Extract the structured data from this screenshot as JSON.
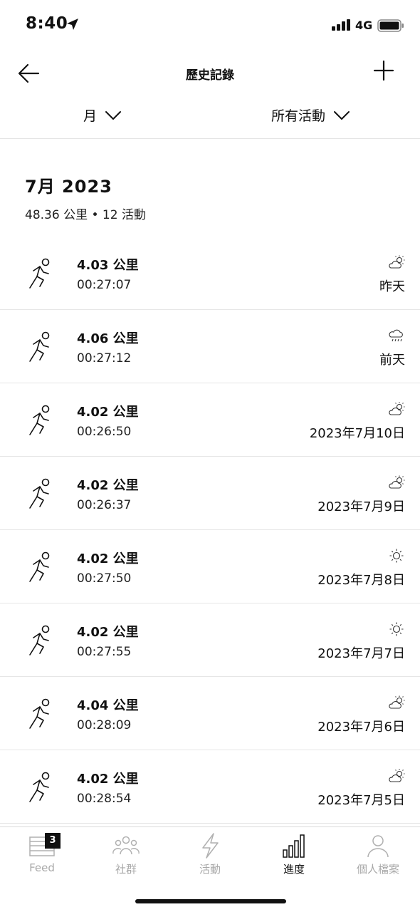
{
  "status_bar": {
    "time": "8:40",
    "network": "4G"
  },
  "nav": {
    "title": "歷史記錄"
  },
  "filters": {
    "period": "月",
    "activity": "所有活動"
  },
  "summary": {
    "title": "7月 2023",
    "subtitle": "48.36 公里 • 12 活動"
  },
  "activities": [
    {
      "distance": "4.03 公里",
      "duration": "00:27:07",
      "date": "昨天",
      "weather": "partly-sunny-icon"
    },
    {
      "distance": "4.06 公里",
      "duration": "00:27:12",
      "date": "前天",
      "weather": "rain-icon"
    },
    {
      "distance": "4.02 公里",
      "duration": "00:26:50",
      "date": "2023年7月10日",
      "weather": "partly-sunny-icon"
    },
    {
      "distance": "4.02 公里",
      "duration": "00:26:37",
      "date": "2023年7月9日",
      "weather": "partly-sunny-icon"
    },
    {
      "distance": "4.02 公里",
      "duration": "00:27:50",
      "date": "2023年7月8日",
      "weather": "sun-icon"
    },
    {
      "distance": "4.02 公里",
      "duration": "00:27:55",
      "date": "2023年7月7日",
      "weather": "sun-icon"
    },
    {
      "distance": "4.04 公里",
      "duration": "00:28:09",
      "date": "2023年7月6日",
      "weather": "partly-sunny-icon"
    },
    {
      "distance": "4.02 公里",
      "duration": "00:28:54",
      "date": "2023年7月5日",
      "weather": "partly-sunny-icon"
    }
  ],
  "tabs": [
    {
      "label": "Feed",
      "icon": "feed-icon",
      "badge": "3"
    },
    {
      "label": "社群",
      "icon": "community-icon"
    },
    {
      "label": "活動",
      "icon": "lightning-icon"
    },
    {
      "label": "進度",
      "icon": "bar-chart-icon",
      "active": true
    },
    {
      "label": "個人檔案",
      "icon": "profile-icon"
    }
  ],
  "colors": {
    "text": "#111111",
    "inactive": "#a8a8a8",
    "divider": "#e6e6e6"
  }
}
